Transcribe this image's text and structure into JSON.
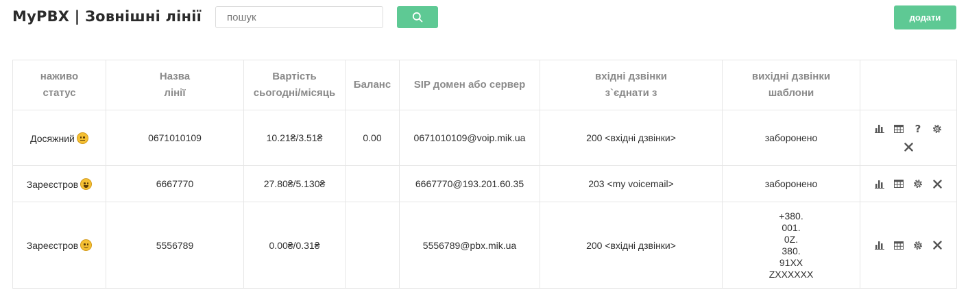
{
  "header": {
    "title": "MyPBX | Зовнішні лінії",
    "search_placeholder": "пошук",
    "add_label": "додати",
    "accent_color": "#5ec994"
  },
  "table": {
    "columns": [
      {
        "line1": "наживо",
        "line2": "статус"
      },
      {
        "line1": "Назва",
        "line2": "лінії"
      },
      {
        "line1": "Вартість",
        "line2": "сьогодні/місяць"
      },
      {
        "line1": "Баланс",
        "line2": ""
      },
      {
        "line1": "SIP домен або сервер",
        "line2": ""
      },
      {
        "line1": "вхідні дзвінки",
        "line2": "з`єднати з"
      },
      {
        "line1": "вихідні дзвінки",
        "line2": "шаблони"
      },
      {
        "line1": "",
        "line2": ""
      }
    ],
    "rows": [
      {
        "status": "Досяжний",
        "status_emoji": "neutral-face-icon",
        "name": "0671010109",
        "cost": "10.21₴/3.51₴",
        "balance": "0.00",
        "sip": "0671010109@voip.mik.ua",
        "incoming": "200 <вхідні дзвінки>",
        "outgoing": [
          "заборонено"
        ]
      },
      {
        "status": "Зареєстров",
        "status_emoji": "grinning-face-icon",
        "name": "6667770",
        "cost": "27.80₴/5.130₴",
        "balance": "",
        "sip": "6667770@193.201.60.35",
        "incoming": "203 <my voicemail>",
        "outgoing": [
          "заборонено"
        ]
      },
      {
        "status": "Зареєстров",
        "status_emoji": "smiling-face-icon",
        "name": "5556789",
        "cost": "0.00₴/0.31₴",
        "balance": "",
        "sip": "5556789@pbx.mik.ua",
        "incoming": "200 <вхідні дзвінки>",
        "outgoing": [
          "+380.",
          "001.",
          "0Z.",
          "380.",
          "91XX",
          "ZXXXXXX"
        ]
      }
    ],
    "row_actions": [
      "bar-chart-icon",
      "grid-icon",
      "help-icon",
      "gear-icon",
      "close-icon"
    ],
    "help_symbol": "?",
    "status_color": "#23a318"
  }
}
